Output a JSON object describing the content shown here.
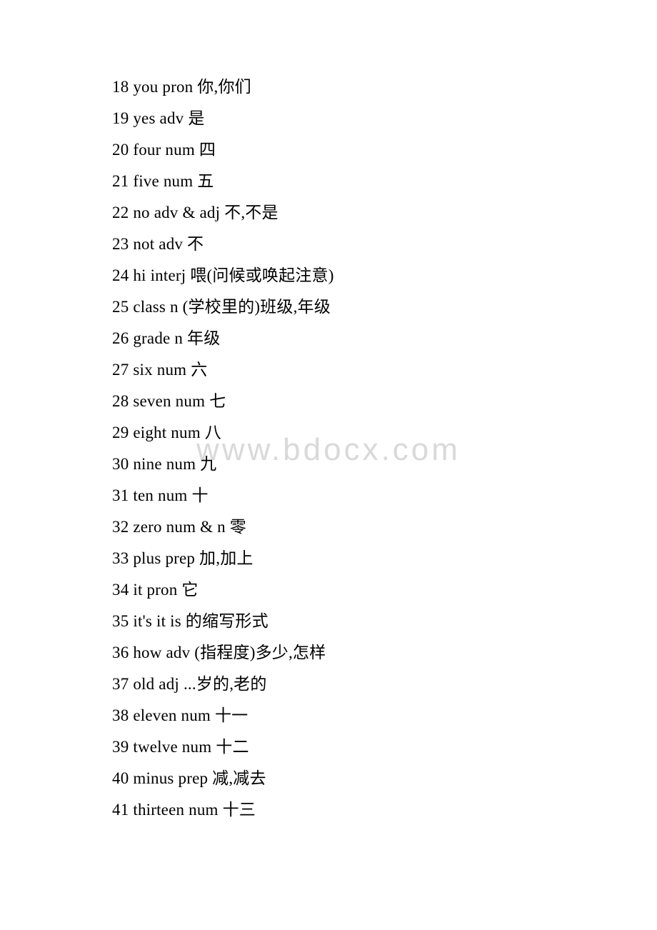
{
  "document": {
    "watermark": "www.bdocx.com",
    "entries": [
      "18 you pron 你,你们",
      "19 yes adv 是",
      "20 four num 四",
      "21 five num 五",
      "22 no adv & adj 不,不是",
      "23 not adv 不",
      "24 hi interj 喂(问候或唤起注意)",
      "25 class n (学校里的)班级,年级",
      "26 grade n 年级",
      "27 six num 六",
      "28 seven num 七",
      "29 eight num 八",
      "30 nine num 九",
      "31 ten num 十",
      "32 zero num & n 零",
      "33 plus prep 加,加上",
      "34 it pron 它",
      "35 it's it is 的缩写形式",
      "36 how adv (指程度)多少,怎样",
      "37 old adj ...岁的,老的",
      "38 eleven num 十一",
      "39 twelve num 十二",
      "40 minus prep 减,减去",
      "41 thirteen num 十三"
    ]
  }
}
